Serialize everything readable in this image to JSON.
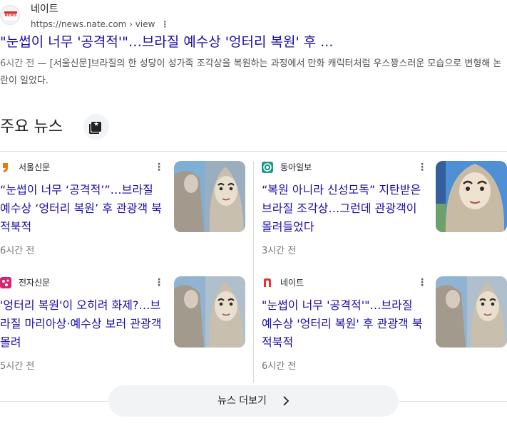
{
  "top_result": {
    "site_name": "네이트",
    "url": "https://news.nate.com › view",
    "favicon_text": "NEWS",
    "title": "\"눈썹이 너무 '공격적'\"…브라질 예수상 '엉터리 복원' 후 ...",
    "snippet_time": "6시간 전",
    "snippet_sep": " — ",
    "snippet": "[서울신문]브라질의 한 성당이 성가족 조각상을 복원하는 과정에서 만화 캐릭터처럼 우스꽝스러운 모습으로 변형해 논란이 일었다."
  },
  "section": {
    "title": "주요 뉴스"
  },
  "cards": [
    {
      "source": "서울신문",
      "icon": "seoul-shinmun-icon",
      "headline": "“눈썹이 너무 ‘공격적’”…브라질 예수상 ‘엉터리 복원’ 후 관광객 북적북적",
      "time": "6시간 전"
    },
    {
      "source": "동아일보",
      "icon": "donga-ilbo-icon",
      "headline": "“복원 아니라 신성모독” 지탄받은 브라질 조각상…그런데 관광객이 몰려들었다",
      "time": "3시간 전"
    },
    {
      "source": "전자신문",
      "icon": "etnews-icon",
      "headline": "'엉터리 복원'이 오히려 화제?…브라질 마리아상·예수상 보러 관광객 몰려",
      "time": "5시간 전"
    },
    {
      "source": "네이트",
      "icon": "nate-icon",
      "headline": "\"눈썹이 너무 '공격적'\"…브라질 예수상 '엉터리 복원' 후 관광객 북적북적",
      "time": "6시간 전"
    }
  ],
  "more_button": {
    "label": "뉴스 더보기"
  },
  "colors": {
    "link": "#1a0dab",
    "text": "#202124",
    "muted": "#70757a",
    "divider": "#dadce0",
    "button_bg": "#f1f3f4",
    "donga": "#1b9a8a",
    "etnews": "#d6246e",
    "nate": "#e8322e",
    "seoul": "#f2760f"
  }
}
